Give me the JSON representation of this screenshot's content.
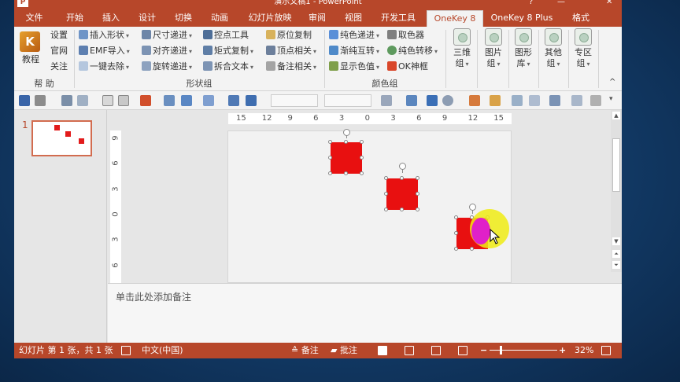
{
  "app": {
    "icon": "powerpoint-icon",
    "title": "演示文稿1 - PowerPoint",
    "help": "?",
    "minimize": "—",
    "close": "✕"
  },
  "tabs": {
    "file": "文件",
    "items": [
      "开始",
      "插入",
      "设计",
      "切换",
      "动画",
      "幻灯片放映",
      "审阅",
      "视图",
      "开发工具",
      "OneKey 8",
      "OneKey 8 Plus",
      "格式"
    ],
    "active": "OneKey 8"
  },
  "ribbon": {
    "help_group": {
      "tutorial": "教程",
      "settings": "设置",
      "website": "官网",
      "follow": "关注",
      "label": "帮 助"
    },
    "shape_group": {
      "col1": [
        "插入形状",
        "EMF导入",
        "一键去除"
      ],
      "col2": [
        "尺寸递进",
        "对齐递进",
        "旋转递进"
      ],
      "col3": [
        "控点工具",
        "矩式复制",
        "拆合文本"
      ],
      "col4": [
        "原位复制",
        "顶点相关",
        "备注相关"
      ],
      "label": "形状组"
    },
    "color_group": {
      "col1": [
        "纯色递进",
        "渐纯互转",
        "显示色值"
      ],
      "col2": [
        "取色器",
        "纯色转移",
        "OK神框"
      ],
      "label": "颜色组"
    },
    "big_buttons": [
      {
        "line1": "三维",
        "line2": "组"
      },
      {
        "line1": "图片",
        "line2": "组"
      },
      {
        "line1": "图形",
        "line2": "库"
      },
      {
        "line1": "其他",
        "line2": "组"
      },
      {
        "line1": "专区",
        "line2": "组"
      }
    ],
    "collapse": "^"
  },
  "ruler": {
    "h_ticks": [
      "15",
      "12",
      "9",
      "6",
      "3",
      "0",
      "3",
      "6",
      "9",
      "12",
      "15"
    ],
    "v_ticks": [
      "9",
      "6",
      "3",
      "0",
      "3",
      "6"
    ]
  },
  "thumbnail": {
    "number": "1"
  },
  "notes": {
    "placeholder": "单击此处添加备注"
  },
  "status": {
    "slide_info": "幻灯片 第 1 张，共 1 张",
    "language": "中文(中国)",
    "notes_btn": "备注",
    "comments_btn": "批注",
    "zoom_minus": "−",
    "zoom_plus": "+",
    "zoom": "32%",
    "zoom_fraction": 0.32
  },
  "colors": {
    "accent": "#b7472a",
    "shape_fill": "#e81010",
    "cursor_halo": "#f0ec14",
    "cursor_mag": "#e020c8"
  }
}
